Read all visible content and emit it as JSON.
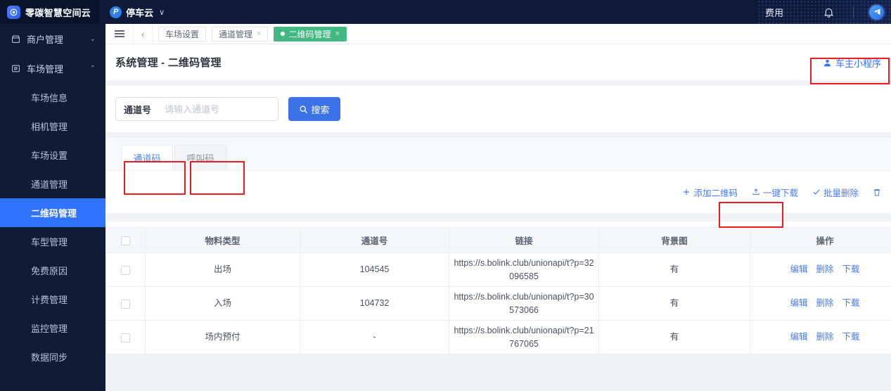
{
  "topbar": {
    "brand_name": "零碳智慧空间云",
    "brand_logo_icon": "circle-target-icon",
    "app_icon_text": "P",
    "app_name": "停车云",
    "app_chevron": "∨",
    "fee_label": "费用",
    "bell_icon": "bell-icon",
    "avatar_icon": "paper-plane-icon"
  },
  "sidebar": {
    "groups": [
      {
        "label": "商户管理",
        "icon": "merchant-icon",
        "chevron": "⌄",
        "expanded": false
      },
      {
        "label": "车场管理",
        "icon": "parking-lot-icon",
        "chevron": "⌃",
        "expanded": true
      }
    ],
    "items": [
      {
        "label": "车场信息",
        "active": false
      },
      {
        "label": "相机管理",
        "active": false
      },
      {
        "label": "车场设置",
        "active": false
      },
      {
        "label": "通道管理",
        "active": false
      },
      {
        "label": "二维码管理",
        "active": true
      },
      {
        "label": "车型管理",
        "active": false
      },
      {
        "label": "免费原因",
        "active": false
      },
      {
        "label": "计费管理",
        "active": false
      },
      {
        "label": "监控管理",
        "active": false
      },
      {
        "label": "数据同步",
        "active": false
      }
    ]
  },
  "tabstrip": {
    "menu_icon": "hamburger-icon",
    "back_icon": "‹",
    "tabs": [
      {
        "label": "车场设置",
        "closable": false,
        "active": false
      },
      {
        "label": "通道管理",
        "closable": true,
        "active": false
      },
      {
        "label": "二维码管理",
        "closable": true,
        "active": true
      }
    ],
    "close_glyph": "×"
  },
  "page": {
    "title": "系统管理 - 二维码管理",
    "owner_button": "车主小程序",
    "owner_button_icon": "user-icon"
  },
  "search": {
    "field_label": "通道号",
    "placeholder": "请输入通道号",
    "value": "",
    "button_label": "搜索",
    "button_icon": "search-icon"
  },
  "subtabs": [
    {
      "label": "通道码",
      "active": true
    },
    {
      "label": "呼叫码",
      "active": false
    }
  ],
  "toolbar": {
    "buttons": [
      {
        "label": "添加二维码",
        "icon": "plus-icon"
      },
      {
        "label": "一键下载",
        "icon": "upload-icon"
      },
      {
        "label": "批量删除",
        "icon": "check-icon"
      },
      {
        "label": "",
        "icon": "trash-icon"
      }
    ]
  },
  "table": {
    "columns": [
      "",
      "物料类型",
      "通道号",
      "链接",
      "背景图",
      "操作"
    ],
    "rows": [
      {
        "material_type": "出场",
        "channel_no": "104545",
        "link": "https://s.bolink.club/unionapi/t?p=32096585",
        "background": "有",
        "actions": [
          "编辑",
          "删除",
          "下载"
        ]
      },
      {
        "material_type": "入场",
        "channel_no": "104732",
        "link": "https://s.bolink.club/unionapi/t?p=30573066",
        "background": "有",
        "actions": [
          "编辑",
          "删除",
          "下载"
        ]
      },
      {
        "material_type": "场内预付",
        "channel_no": "-",
        "link": "https://s.bolink.club/unionapi/t?p=21767065",
        "background": "有",
        "actions": [
          "编辑",
          "删除",
          "下载"
        ]
      }
    ]
  },
  "colors": {
    "header_bg": "#0e1a38",
    "sidebar_bg": "#101c36",
    "sidebar_active": "#2f73ff",
    "accent_blue": "#3b72e8",
    "link_blue": "#4a7cf5",
    "tab_active_green": "#42b983",
    "annotation_red": "#ed1c24",
    "page_bg": "#f0f2f5"
  }
}
